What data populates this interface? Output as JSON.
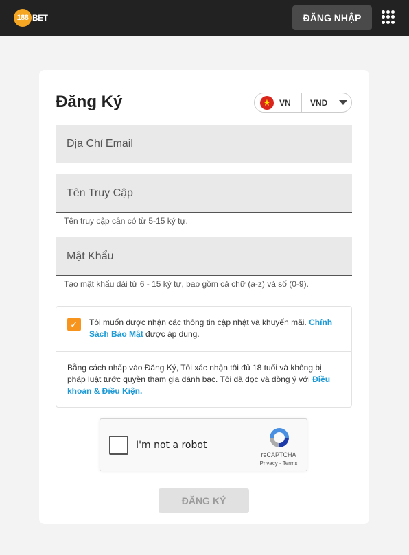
{
  "header": {
    "logo_text": "188BET",
    "login_label": "ĐĂNG NHẬP",
    "menu_icon": "apps-grid-icon"
  },
  "form": {
    "title": "Đăng Ký",
    "locale": {
      "flag_icon": "vietnam-flag-icon",
      "language": "VN",
      "currency": "VND"
    },
    "email": {
      "placeholder": "Địa Chỉ Email",
      "value": ""
    },
    "username": {
      "placeholder": "Tên Truy Cập",
      "value": "",
      "hint": "Tên truy cập cần có từ 5-15 ký tự."
    },
    "password": {
      "placeholder": "Mật Khẩu",
      "value": "",
      "hint": "Tạo mật khẩu dài từ 6 - 15 ký tự, bao gồm cả chữ (a-z) và số (0-9)."
    },
    "marketing": {
      "checked": true,
      "text": "Tôi muốn được nhận các thông tin cập nhật và khuyến mãi.",
      "link": "Chính Sách Bảo Mật",
      "suffix": "được áp dụng."
    },
    "terms": {
      "text": "Bằng cách nhấp vào Đăng Ký, Tôi xác nhận tôi đủ 18 tuổi và không bị pháp luật tước quyền tham gia đánh bạc. Tôi đã đọc và đồng ý với",
      "link": "Điều khoản & Điều Kiện."
    },
    "captcha": {
      "label": "I'm not a robot",
      "brand": "reCAPTCHA",
      "privacy": "Privacy",
      "terms": "Terms",
      "separator": " - "
    },
    "submit_label": "ĐĂNG KÝ"
  },
  "colors": {
    "header_bg": "#222222",
    "accent": "#f7941d",
    "link": "#1e9bd7",
    "page_bg": "#f3f3f3"
  }
}
